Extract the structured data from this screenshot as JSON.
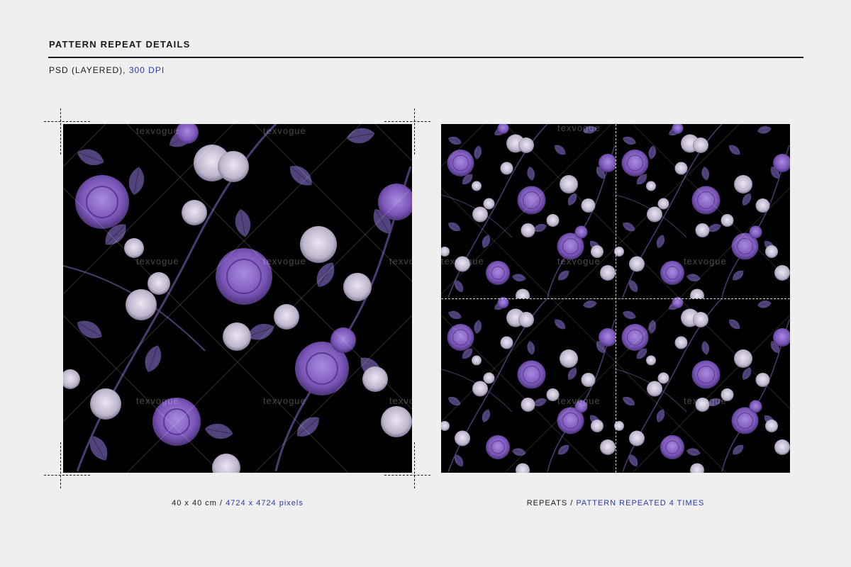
{
  "header": {
    "title": "PATTERN REPEAT DETAILS",
    "format": "PSD (LAYERED), ",
    "dpi": "300 DPI"
  },
  "watermark": "texvogue",
  "left_panel": {
    "size": "40 x 40 cm / ",
    "pixels": "4724 x 4724 pixels"
  },
  "right_panel": {
    "label": "REPEATS / ",
    "detail": "PATTERN REPEATED 4 TIMES"
  },
  "colors": {
    "background": "#efefef",
    "accent": "#2a3aa8",
    "pattern_bg": "#000000",
    "rose_purple": "#8c63c9",
    "rose_pale": "#c9c2d6",
    "leaf": "#5a4a86"
  },
  "icons": [
    "floral-pattern-tile"
  ]
}
